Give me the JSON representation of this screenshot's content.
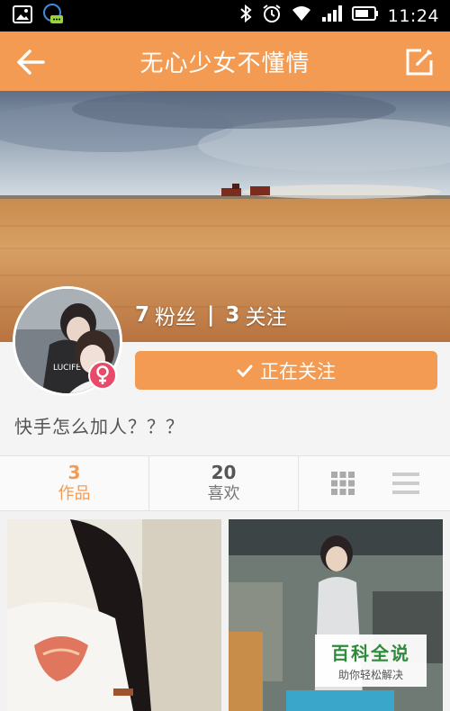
{
  "status_bar": {
    "time": "11:24",
    "icons": [
      "image-icon",
      "chat-bubble-icon",
      "bluetooth-icon",
      "alarm-icon",
      "wifi-icon",
      "signal-icon",
      "battery-icon"
    ]
  },
  "header": {
    "title": "无心少女不懂情",
    "back_icon": "arrow-left-icon",
    "edit_icon": "edit-icon"
  },
  "profile": {
    "followers_count": "7",
    "followers_label": "粉丝",
    "separator": "|",
    "following_count": "3",
    "following_label": "关注",
    "follow_button_label": "正在关注",
    "gender": "female",
    "bio": "快手怎么加人？？？"
  },
  "tabs": [
    {
      "count": "3",
      "label": "作品",
      "active": true
    },
    {
      "count": "20",
      "label": "喜欢",
      "active": false
    }
  ],
  "view_toggle": {
    "grid_icon": "grid-view-icon",
    "list_icon": "list-view-icon"
  },
  "watermark": {
    "main": "百科全说",
    "sub": "助你轻松解决"
  },
  "colors": {
    "accent": "#f39b52",
    "gender_badge": "#e94a69",
    "status_bar": "#000000"
  }
}
